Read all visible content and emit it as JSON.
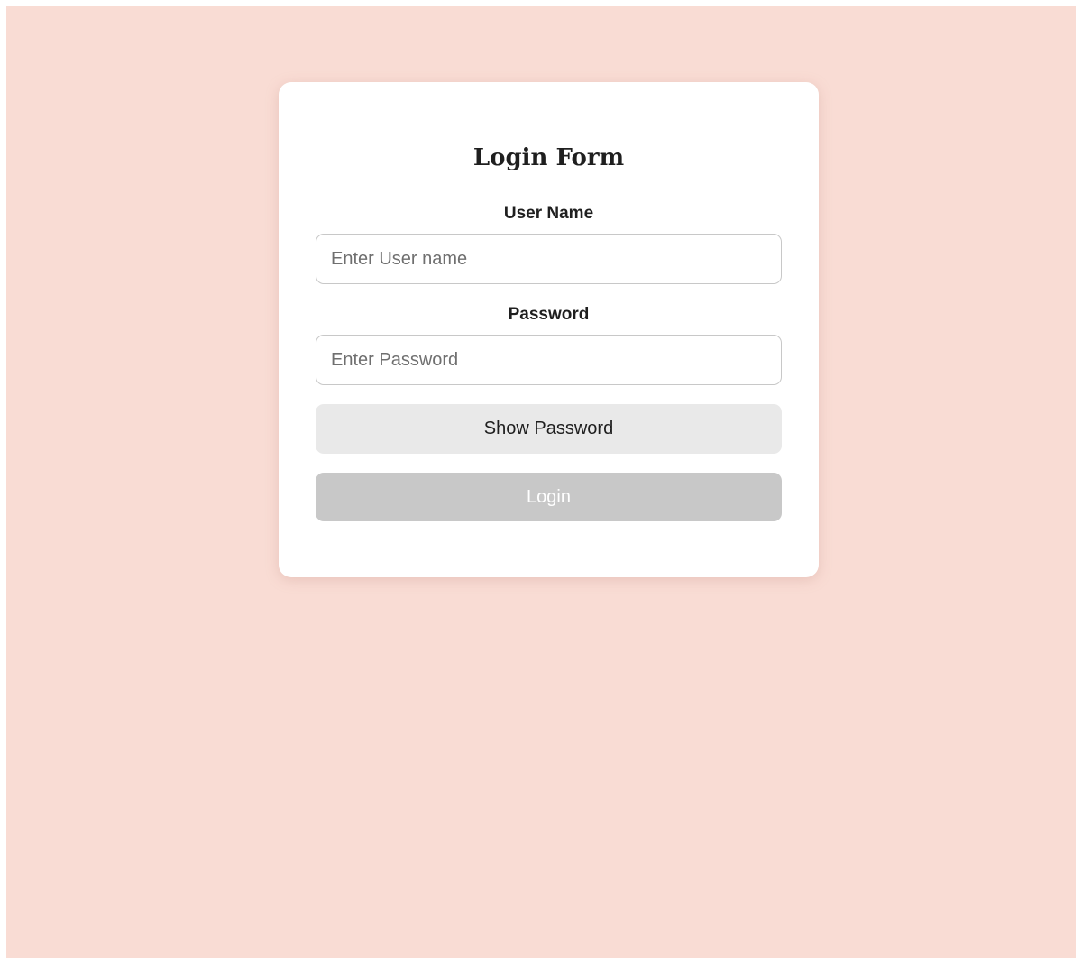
{
  "colors": {
    "page_background": "#f9dcd4",
    "card_background": "#ffffff",
    "show_button_background": "#e9e9e9",
    "login_button_background": "#c8c8c8"
  },
  "form": {
    "title": "Login Form",
    "username": {
      "label": "User Name",
      "value": "",
      "placeholder": "Enter User name"
    },
    "password": {
      "label": "Password",
      "value": "",
      "placeholder": "Enter Password"
    },
    "show_password_label": "Show Password",
    "login_label": "Login"
  }
}
